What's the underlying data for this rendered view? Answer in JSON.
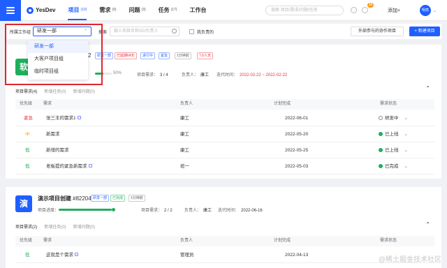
{
  "nav": {
    "brand": "YesDev",
    "items": [
      {
        "label": "项目",
        "count": "(10)",
        "active": true
      },
      {
        "label": "需求",
        "count": "(9)",
        "active": false
      },
      {
        "label": "问题",
        "count": "(3)",
        "active": false
      },
      {
        "label": "任务",
        "count": "(17)",
        "active": false
      },
      {
        "label": "工作台",
        "count": "",
        "active": false
      }
    ],
    "search_placeholder": "搜索 项目/需求/问题/任务",
    "badge": "38",
    "add_label": "添加+",
    "avatar_text": "明亮"
  },
  "filter": {
    "workgroup_label": "所属工作组",
    "workgroup_value": "研发一部",
    "search_label": "搜索",
    "search_placeholder": "输入项目名称/ID/负责人",
    "mine_label": "我负责的",
    "external_button": "外部参与的协作项目",
    "new_button": "+ 新建项目"
  },
  "dropdown": {
    "options": [
      "研发一部",
      "大客户项目组",
      "临时项目组"
    ],
    "selected": 0
  },
  "projects": [
    {
      "icon_text": "软",
      "icon_color": "#1fae5c",
      "title": "",
      "code": "2",
      "tags": [
        "研发一部",
        "已延期64天",
        "进行中",
        "紧急",
        "1分钟前",
        "7.6人天"
      ],
      "progress_label": "项目进度：",
      "progress_value": 0.5,
      "progress_text": "50%",
      "req_label": "项目需求：",
      "req_value": "3 / 4",
      "owner_label": "负责人：",
      "owner_value": "康工",
      "period_label": "迭代时间：",
      "period_value": "2022-02-22 ~ 2022-02-22",
      "tabs": [
        "项目需求(4)",
        "新增任务(0)",
        "新增问题(0)"
      ],
      "columns": [
        "优先级",
        "需求",
        "负责人",
        "计划完成",
        "需求状态"
      ],
      "rows": [
        {
          "priority": "紧急",
          "priority_color": "#e8303a",
          "title": "张三丰的需求1",
          "owner": "康工",
          "due": "2022-06-01",
          "status": "研发中",
          "done": false
        },
        {
          "priority": "中",
          "priority_color": "#ff9b1a",
          "title": "新需求",
          "owner": "康工",
          "due": "2022-05-20",
          "status": "已上线",
          "done": true
        },
        {
          "priority": "低",
          "priority_color": "#1fae5c",
          "title": "新增的需求",
          "owner": "康工",
          "due": "2022-05-25",
          "status": "已上线",
          "done": true
        },
        {
          "priority": "低",
          "priority_color": "#1fae5c",
          "title": "老板提的紧急新需求",
          "owner": "班一",
          "due": "2022-05-03",
          "status": "已完成",
          "done": true
        }
      ]
    },
    {
      "icon_text": "演",
      "icon_color": "#1f5fff",
      "title": "演示项目创建",
      "code": "#82204",
      "tags": [
        "研发一部",
        "已完成",
        "1分钟前"
      ],
      "progress_label": "项目进度：",
      "progress_value": 1.0,
      "req_label": "项目需求：",
      "req_value": "2 / 2",
      "owner_label": "负责人：",
      "owner_value": "康工",
      "period_label": "迭代时间：",
      "period_value": "2022-06-16",
      "tabs": [
        "项目需求(2)",
        "新增任务(0)",
        "新增问题(0)"
      ],
      "columns": [
        "优先级",
        "需求",
        "负责人",
        "计划完成",
        "需求状态"
      ],
      "rows": [
        {
          "priority": "低",
          "priority_color": "#1fae5c",
          "title": "这就是个需求",
          "owner": "管理员",
          "due": "2022-04-13",
          "status": "",
          "done": false
        }
      ]
    }
  ],
  "watermark": "@稀土掘金技术社区"
}
